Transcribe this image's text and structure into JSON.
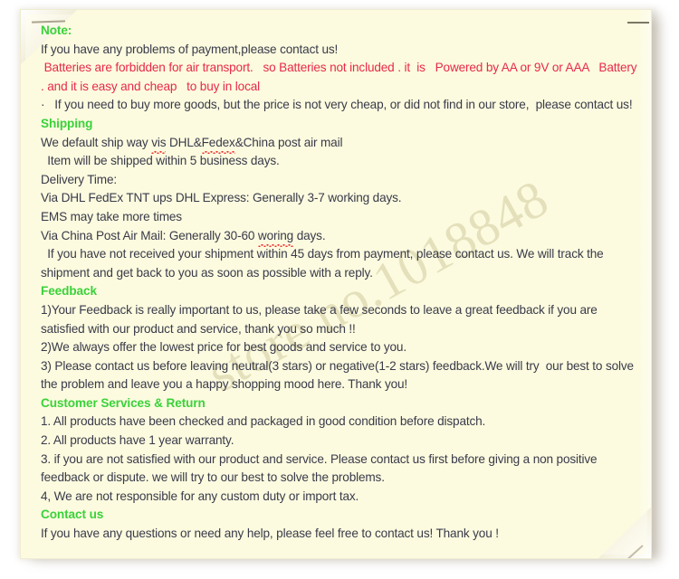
{
  "watermark": "store no.1018848",
  "colors": {
    "page_background": "#FCFBDF",
    "heading_green": "#3AD23A",
    "body_text": "#3A3A4A",
    "alert_red": "#E8294A",
    "watermark": "#E4E0BB"
  },
  "sections": {
    "note": {
      "heading": "Note:",
      "lines": [
        "If you have any problems of payment,please contact us!",
        " Batteries are forbidden for air transport.   so Batteries not included . it  is   Powered by AA or 9V or AAA   Battery . and it is easy and cheap   to buy in local",
        "·   If you need to buy more goods, but the price is not very cheap, or did not find in our store,  please contact us!"
      ]
    },
    "shipping": {
      "heading": "Shipping",
      "line_ship_way_a": "We default ship way ",
      "line_ship_way_vis": "vis",
      "line_ship_way_b": " DHL&",
      "line_ship_way_fedex": "Fedex",
      "line_ship_way_c": "&China post air mail",
      "line_item_days": "  Item will be shipped within 5 business days.",
      "delivery_time_label": "Delivery Time:",
      "delivery_dhl": "Via DHL FedEx TNT ups DHL Express: Generally 3-7 working days.",
      "delivery_ems": "EMS may take more times",
      "delivery_china_a": "Via China Post Air Mail: Generally 30-60 ",
      "delivery_china_woring": "woring",
      "delivery_china_b": " days.",
      "not_received": "  If you have not received your shipment within 45 days from payment, please contact us. We will track the shipment and get back to you as soon as possible with a reply."
    },
    "feedback": {
      "heading": "Feedback",
      "items": [
        "1)Your Feedback is really important to us, please take a few seconds to leave a great feedback if you are satisfied with our product and service, thank you so much !!",
        "2)We always offer the lowest price for best goods and service to you.",
        "3) Please contact us before leaving neutral(3 stars) or negative(1-2 stars) feedback.We will try  our best to solve the problem and leave you a happy shopping mood here. Thank you!"
      ]
    },
    "customer_services": {
      "heading": "Customer Services & Return",
      "items": [
        "1. All products have been checked and packaged in good condition before dispatch.",
        "2. All products have 1 year warranty.",
        "3. if you are not satisfied with our product and service. Please contact us first before giving a non positive feedback or dispute. we will try to our best to solve the problems.",
        "4, We are not responsible for any custom duty or import tax."
      ]
    },
    "contact": {
      "heading": "Contact us",
      "lines": [
        "If you have any questions or need any help, please feel free to contact us! Thank you !"
      ]
    }
  }
}
